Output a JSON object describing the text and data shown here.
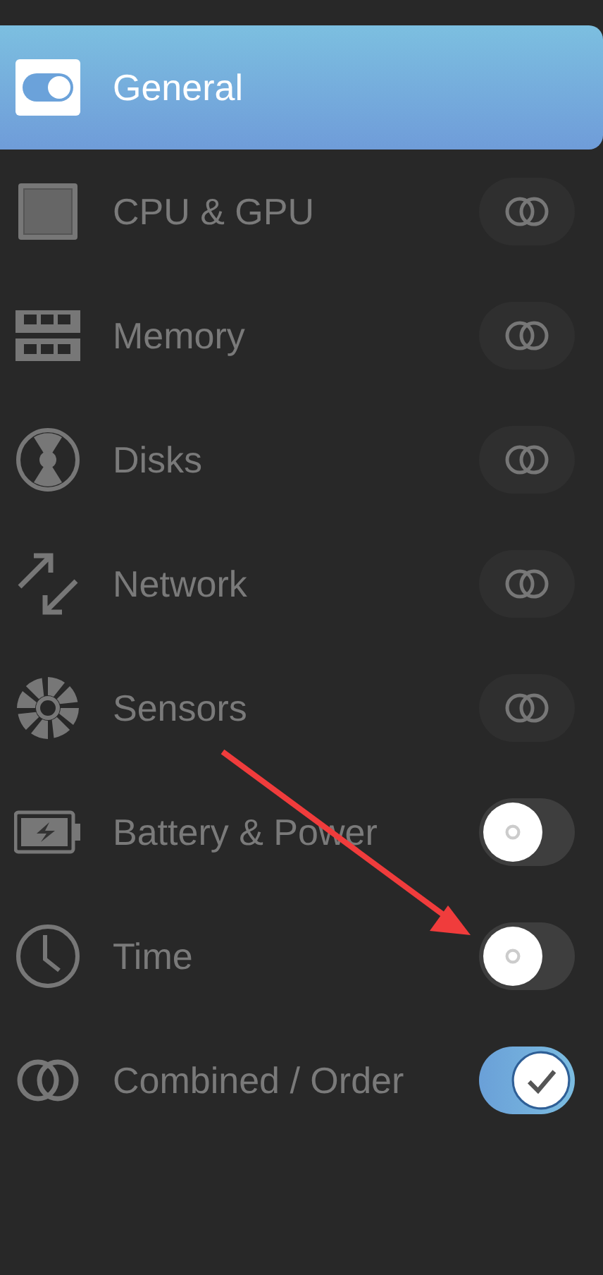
{
  "sidebar": {
    "items": [
      {
        "label": "General",
        "selected": true
      },
      {
        "label": "CPU & GPU",
        "selected": false,
        "control": {
          "kind": "combine"
        }
      },
      {
        "label": "Memory",
        "selected": false,
        "control": {
          "kind": "combine"
        }
      },
      {
        "label": "Disks",
        "selected": false,
        "control": {
          "kind": "combine"
        }
      },
      {
        "label": "Network",
        "selected": false,
        "control": {
          "kind": "combine"
        }
      },
      {
        "label": "Sensors",
        "selected": false,
        "control": {
          "kind": "combine"
        }
      },
      {
        "label": "Battery & Power",
        "selected": false,
        "control": {
          "kind": "toggle",
          "on": false
        }
      },
      {
        "label": "Time",
        "selected": false,
        "control": {
          "kind": "toggle",
          "on": false
        }
      },
      {
        "label": "Combined / Order",
        "selected": false,
        "control": {
          "kind": "toggle",
          "on": true
        }
      }
    ]
  },
  "annotation": {
    "kind": "arrow"
  }
}
